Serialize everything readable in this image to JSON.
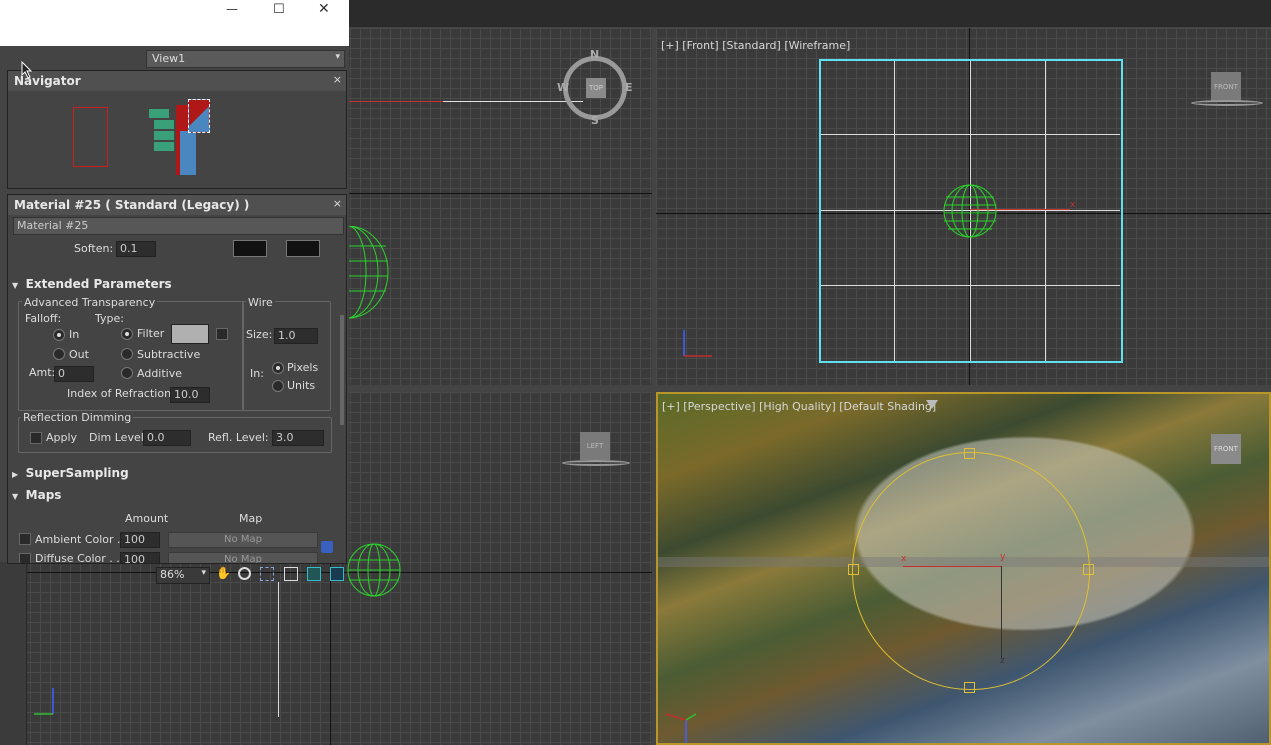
{
  "window": {
    "minimize": "—",
    "maximize": "☐",
    "close": "✕"
  },
  "view_select": {
    "value": "View1",
    "arrow": "▾"
  },
  "navigator": {
    "title": "Navigator",
    "close": "×"
  },
  "material": {
    "title": "Material #25  ( Standard (Legacy) )",
    "close": "×",
    "name_field": "Material #25",
    "soften_label": "Soften:",
    "soften_value": "0.1",
    "extended": {
      "header": "Extended Parameters",
      "adv_trans": "Advanced Transparency",
      "falloff": "Falloff:",
      "type": "Type:",
      "in": "In",
      "out": "Out",
      "filter": "Filter",
      "subtractive": "Subtractive",
      "additive": "Additive",
      "amt_label": "Amt:",
      "amt_value": "0",
      "ior_label": "Index of Refraction:",
      "ior_value": "10.0",
      "wire": "Wire",
      "size_label": "Size:",
      "size_value": "1.0",
      "in_label": "In:",
      "pixels": "Pixels",
      "units": "Units",
      "refl_dim": "Reflection Dimming",
      "apply": "Apply",
      "dim_label": "Dim Level:",
      "dim_value": "0.0",
      "refl_label": "Refl. Level:",
      "refl_value": "3.0"
    },
    "supersampling": "SuperSampling",
    "maps": {
      "header": "Maps",
      "amount_col": "Amount",
      "map_col": "Map",
      "rows": [
        {
          "label": "Ambient Color . .",
          "amount": "100",
          "map": "No Map"
        },
        {
          "label": "Diffuse Color . . .",
          "amount": "100",
          "map": "No Map"
        }
      ]
    },
    "zoom": "86%"
  },
  "viewports": {
    "front_label": "[+] [Front] [Standard] [Wireframe]",
    "persp_label": "[+] [Perspective] [High Quality] [Default Shading]",
    "top_cube": "TOP",
    "front_cube": "FRONT",
    "left_cube": "LEFT",
    "compass": {
      "n": "N",
      "s": "S",
      "e": "E",
      "w": "W"
    },
    "axis_x": "x",
    "axis_y": "y",
    "axis_z": "z"
  },
  "colors": {
    "accent_cyan": "#5fe0f0",
    "wire_green": "#2bd42b",
    "gizmo_yellow": "#e0c030",
    "nav_red": "#b01818",
    "nav_blue": "#4a86c0",
    "nav_green": "#3aa07a"
  }
}
